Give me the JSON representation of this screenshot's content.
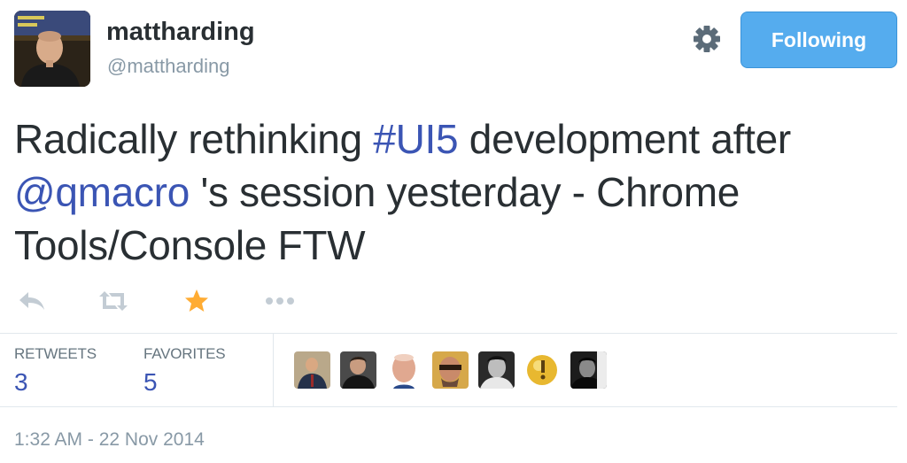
{
  "tweet": {
    "user": {
      "display_name": "mattharding",
      "screen_name": "@mattharding",
      "follow_button_label": "Following",
      "settings_icon": "gear-icon"
    },
    "text": {
      "part1": "Radically rethinking ",
      "hashtag": "#UI5",
      "part2": " development after",
      "mention": "@qmacro",
      "part3": " 's session yesterday - Chrome Tools/Console FTW"
    },
    "actions": [
      {
        "name": "reply",
        "icon": "reply-icon"
      },
      {
        "name": "retweet",
        "icon": "retweet-icon"
      },
      {
        "name": "favorite",
        "icon": "star-icon"
      },
      {
        "name": "more",
        "icon": "more-icon"
      }
    ],
    "stats": {
      "retweets_label": "RETWEETS",
      "retweets_count": "3",
      "favorites_label": "FAVORITES",
      "favorites_count": "5"
    },
    "timestamp": "1:32 AM - 22 Nov 2014",
    "colors": {
      "link": "#3b55b4",
      "follow_button": "#55acee",
      "favorite_active": "#ffac33",
      "muted_text": "#8899a6"
    }
  }
}
